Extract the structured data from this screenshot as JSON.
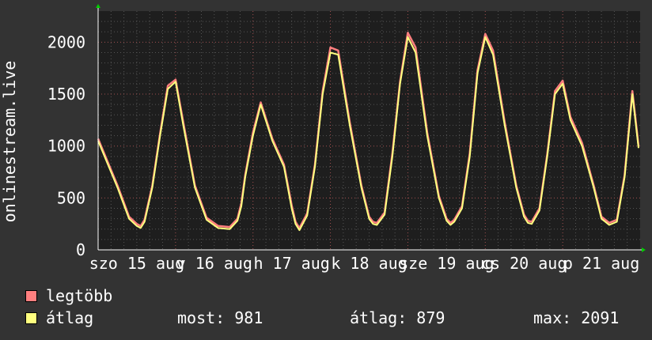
{
  "chart_data": {
    "type": "line",
    "ylabel": "onlinestream.live",
    "ylim": [
      0,
      2300
    ],
    "y_ticks": [
      0,
      500,
      1000,
      1500,
      2000
    ],
    "x_tick_labels": [
      "szo 15 aug",
      "v 16 aug",
      "h 17 aug",
      "k 18 aug",
      "sze 19 aug",
      "cs 20 aug",
      "p 21 aug"
    ],
    "grid": true,
    "series": [
      {
        "name": "legtöbb",
        "color": "#ff7f7f"
      },
      {
        "name": "átlag",
        "color": "#ffff7f"
      }
    ],
    "x_days": [
      0,
      0.25,
      0.4,
      0.5,
      0.55,
      0.6,
      0.7,
      0.8,
      0.9,
      1.0,
      1.1,
      1.25,
      1.4,
      1.55,
      1.7,
      1.8,
      1.85,
      1.9,
      2.0,
      2.1,
      2.25,
      2.4,
      2.5,
      2.55,
      2.6,
      2.7,
      2.8,
      2.9,
      3.0,
      3.1,
      3.25,
      3.4,
      3.5,
      3.55,
      3.6,
      3.7,
      3.8,
      3.9,
      4.0,
      4.1,
      4.25,
      4.4,
      4.5,
      4.55,
      4.6,
      4.7,
      4.8,
      4.9,
      5.0,
      5.1,
      5.25,
      5.4,
      5.5,
      5.55,
      5.6,
      5.7,
      5.8,
      5.9,
      6.0,
      6.1,
      6.25,
      6.4,
      6.5,
      6.6,
      6.7,
      6.8,
      6.9,
      6.98
    ],
    "avg_values": [
      1050,
      600,
      300,
      230,
      210,
      270,
      600,
      1100,
      1550,
      1620,
      1200,
      600,
      290,
      210,
      200,
      280,
      420,
      700,
      1100,
      1400,
      1050,
      800,
      400,
      250,
      190,
      330,
      800,
      1500,
      1900,
      1880,
      1200,
      600,
      300,
      250,
      240,
      340,
      900,
      1600,
      2050,
      1900,
      1100,
      500,
      280,
      240,
      270,
      400,
      900,
      1700,
      2050,
      1880,
      1200,
      600,
      320,
      260,
      250,
      380,
      900,
      1500,
      1600,
      1250,
      1000,
      600,
      300,
      240,
      270,
      700,
      1500,
      980
    ],
    "max_values": [
      1070,
      620,
      320,
      250,
      230,
      290,
      620,
      1120,
      1580,
      1640,
      1230,
      620,
      310,
      230,
      220,
      300,
      450,
      720,
      1130,
      1420,
      1070,
      820,
      430,
      270,
      210,
      350,
      820,
      1530,
      1950,
      1920,
      1230,
      620,
      320,
      270,
      260,
      360,
      930,
      1620,
      2091,
      1950,
      1130,
      520,
      300,
      260,
      290,
      420,
      930,
      1730,
      2080,
      1920,
      1230,
      620,
      340,
      280,
      270,
      400,
      920,
      1530,
      1630,
      1280,
      1030,
      620,
      320,
      260,
      290,
      720,
      1530,
      1000
    ]
  },
  "legend": {
    "items": [
      {
        "label": "legtöbb",
        "color": "#ff7f7f"
      },
      {
        "label": "átlag",
        "color": "#ffff7f"
      }
    ],
    "stats": {
      "current": "most: 981",
      "average": "átlag: 879",
      "max": "max: 2091"
    }
  }
}
